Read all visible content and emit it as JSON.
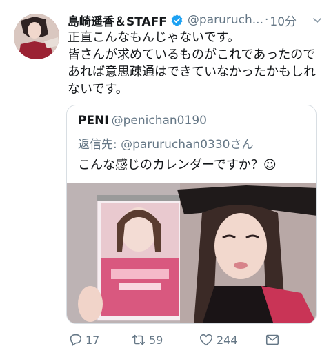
{
  "tweet": {
    "display_name": "島崎遥香＆STAFF",
    "handle": "@paruruch...",
    "separator": "·",
    "time": "10分",
    "text": "正直こんなもんじゃないです。\n皆さんが求めているものがこれであったのであれば意思疎通はできていなかったかもしれないです。"
  },
  "quoted": {
    "name": "PENI",
    "handle": "@penichan0190",
    "reply_prefix": "返信先: ",
    "reply_to": "@paruruchan0330さん",
    "text": "こんな感じのカレンダーですか？☺"
  },
  "actions": {
    "reply_count": "17",
    "retweet_count": "59",
    "like_count": "244"
  },
  "icons": [
    "verified-icon",
    "caret-down-icon",
    "reply-icon",
    "retweet-icon",
    "like-icon",
    "dm-icon"
  ],
  "colors": {
    "verified": "#1da1f2",
    "secondary_text": "#657786",
    "border": "#d8dee3"
  }
}
